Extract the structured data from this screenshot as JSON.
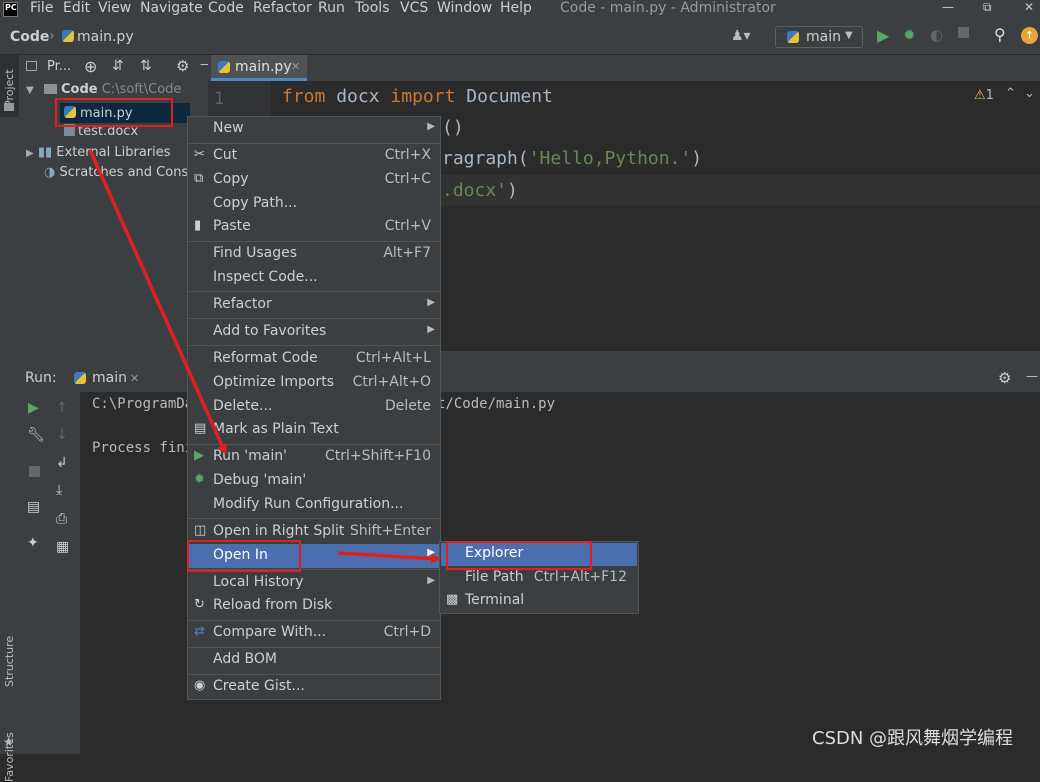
{
  "menubar": {
    "logo": "PC",
    "items": [
      "File",
      "Edit",
      "View",
      "Navigate",
      "Code",
      "Refactor",
      "Run",
      "Tools",
      "VCS",
      "Window",
      "Help"
    ],
    "window_title": "Code - main.py - Administrator"
  },
  "navbar": {
    "breadcrumb_root": "Code",
    "breadcrumb_file": "main.py",
    "run_config": "main"
  },
  "left_stripe": {
    "project": "Project",
    "structure": "Structure",
    "favorites": "Favorites"
  },
  "project_panel": {
    "title": "Pr...",
    "tree": {
      "root_label": "Code",
      "root_path": "C:\\soft\\Code",
      "files": [
        "main.py",
        "test.docx"
      ],
      "external_libraries": "External Libraries",
      "scratches": "Scratches and Consoles"
    }
  },
  "editor": {
    "tab_label": "main.py",
    "line_number": "1",
    "warnings": "1",
    "code": {
      "l1_kw1": "from",
      "l1_mod": " docx ",
      "l1_kw2": "import",
      "l1_name": " Document",
      "l2": "()",
      "l3_a": "ragraph(",
      "l3_str": "'Hello,Python.'",
      "l3_b": ")",
      "l4_str": ".docx'",
      "l4_b": ")"
    }
  },
  "run_panel": {
    "label": "Run:",
    "tab_label": "main",
    "console": {
      "line1_left": "C:\\ProgramDa",
      "line1_right": "t/Code/main.py",
      "line2": "Process fini"
    }
  },
  "context_menu": {
    "new": "New",
    "cut": "Cut",
    "cut_shortcut": "Ctrl+X",
    "copy": "Copy",
    "copy_shortcut": "Ctrl+C",
    "copy_path": "Copy Path...",
    "paste": "Paste",
    "paste_shortcut": "Ctrl+V",
    "find_usages": "Find Usages",
    "find_usages_shortcut": "Alt+F7",
    "inspect_code": "Inspect Code...",
    "refactor": "Refactor",
    "add_to_favorites": "Add to Favorites",
    "reformat_code": "Reformat Code",
    "reformat_code_shortcut": "Ctrl+Alt+L",
    "optimize_imports": "Optimize Imports",
    "optimize_imports_shortcut": "Ctrl+Alt+O",
    "delete": "Delete...",
    "delete_shortcut": "Delete",
    "mark_plain_text": "Mark as Plain Text",
    "run_main": "Run 'main'",
    "run_main_shortcut": "Ctrl+Shift+F10",
    "debug_main": "Debug 'main'",
    "modify_run_config": "Modify Run Configuration...",
    "open_right_split": "Open in Right Split",
    "open_right_split_shortcut": "Shift+Enter",
    "open_in": "Open In",
    "local_history": "Local History",
    "reload_from_disk": "Reload from Disk",
    "compare_with": "Compare With...",
    "compare_with_shortcut": "Ctrl+D",
    "add_bom": "Add BOM",
    "create_gist": "Create Gist..."
  },
  "submenu": {
    "explorer": "Explorer",
    "file_path": "File Path",
    "file_path_shortcut": "Ctrl+Alt+F12",
    "terminal": "Terminal"
  },
  "watermark": "CSDN @跟风舞烟学编程",
  "colors": {
    "accent": "#4b6eaf",
    "annotation": "#e02020",
    "keyword": "#cc7832",
    "string": "#6a8759"
  }
}
